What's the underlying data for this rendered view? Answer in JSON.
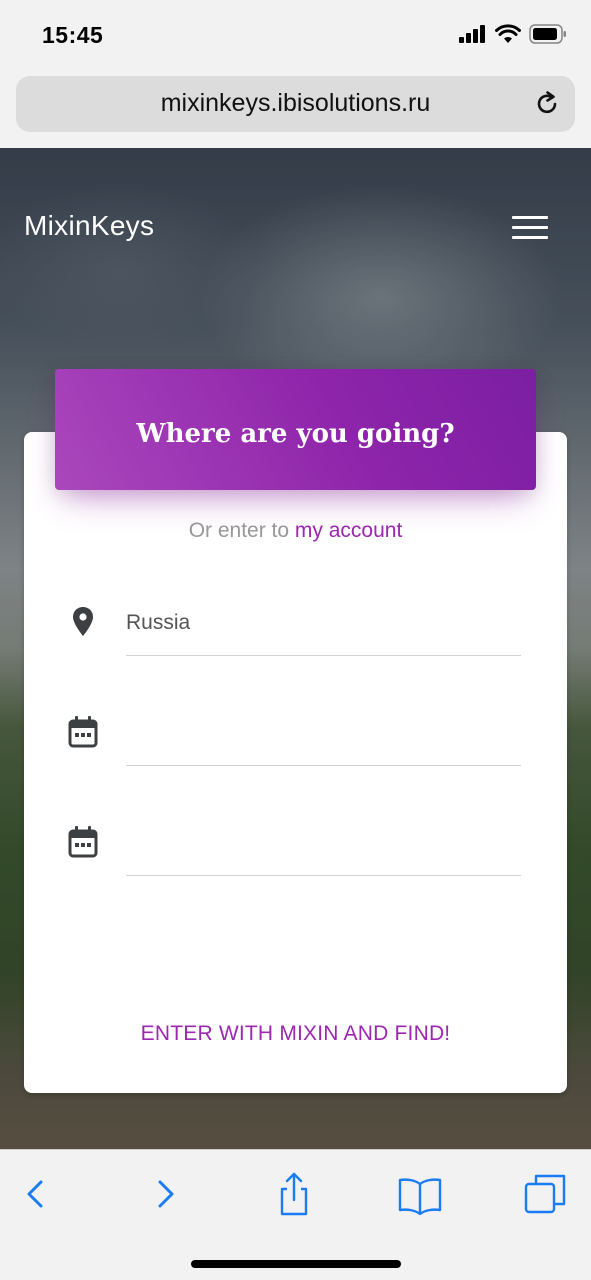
{
  "status_bar": {
    "time": "15:45"
  },
  "browser": {
    "url": "mixinkeys.ibisolutions.ru"
  },
  "site": {
    "brand": "MixinKeys",
    "card_title": "Where are you going?",
    "subtitle_prefix": "Or enter to",
    "subtitle_link": "my account",
    "fields": {
      "destination_value": "Russia",
      "date_from_value": "",
      "date_to_value": ""
    },
    "submit_label": "ENTER WITH MIXIN AND FIND!"
  },
  "colors": {
    "accent": "#9c27b0",
    "ios_blue": "#1a7cf5"
  },
  "icons": {
    "location": "map-marker-icon",
    "calendar": "calendar-icon",
    "back": "chevron-left-icon",
    "forward": "chevron-right-icon",
    "share": "share-icon",
    "bookmarks": "book-icon",
    "tabs": "tabs-icon"
  }
}
